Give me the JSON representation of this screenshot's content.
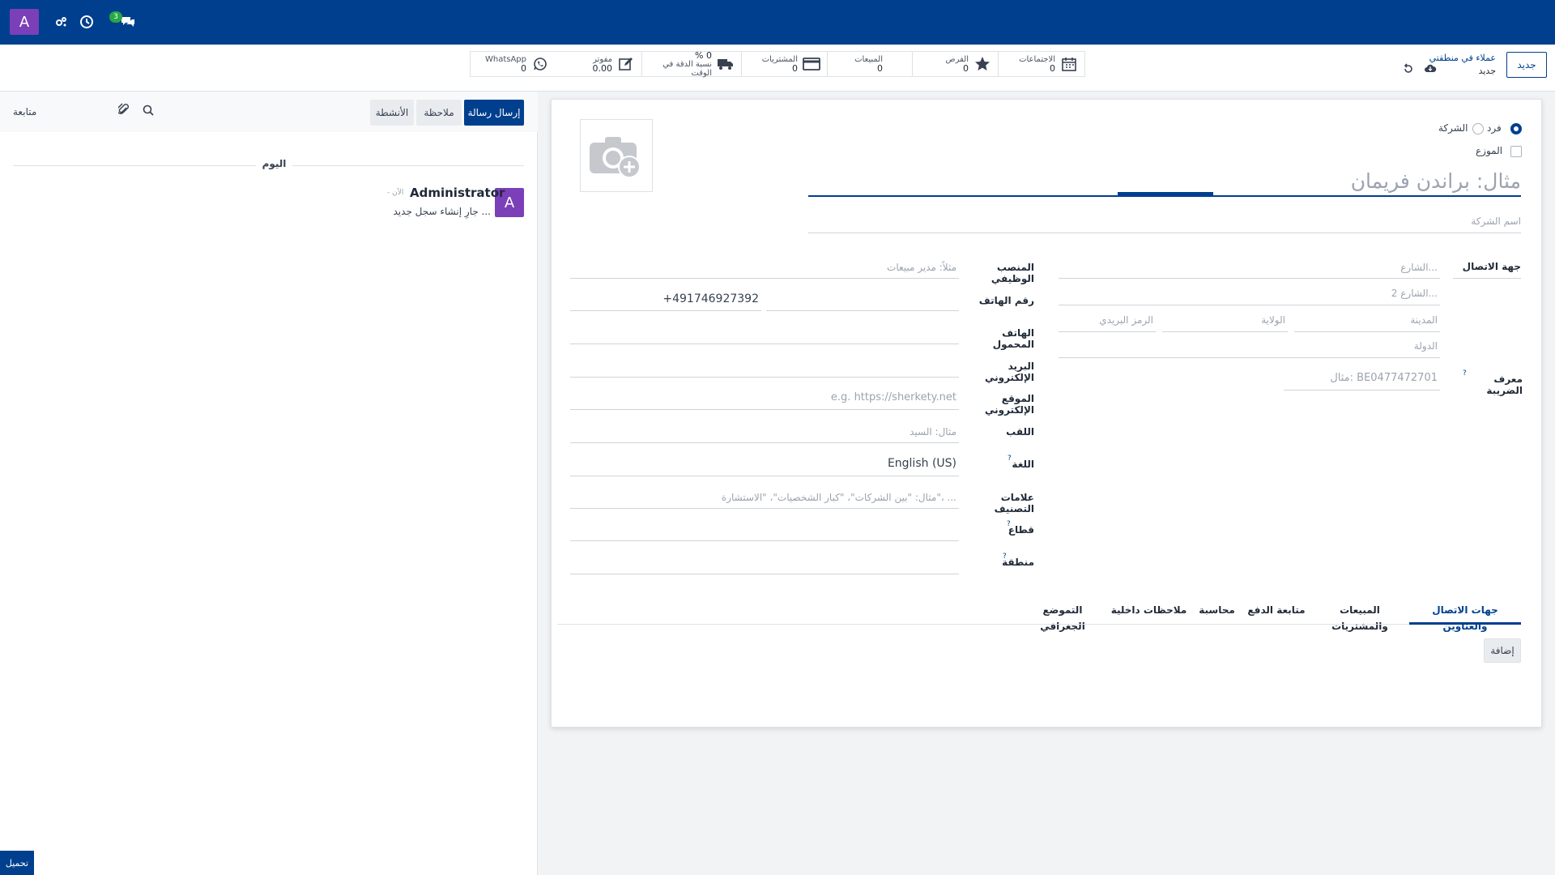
{
  "navbar": {
    "avatar_letter": "A",
    "chat_badge": "3"
  },
  "control": {
    "new_button": "جديد",
    "breadcrumb_parent": "عملاء في منطقتي",
    "breadcrumb_current": "جديد",
    "stats": [
      {
        "label": "الاجتماعات",
        "value": "0",
        "icon": "calendar-icon"
      },
      {
        "label": "الفرص",
        "value": "0",
        "icon": "star-icon"
      },
      {
        "label": "المبيعات",
        "value": "0",
        "icon": "dollar-icon"
      },
      {
        "label": "المشتريات",
        "value": "0",
        "icon": "credit-card-icon"
      },
      {
        "label": "نسبة الدقة في الوقت",
        "value": "0 %",
        "icon": "truck-icon"
      },
      {
        "label": "مفوتر",
        "value": "0.00",
        "icon": "invoice-edit-icon"
      },
      {
        "label": "WhatsApp",
        "value": "0",
        "icon": "whatsapp-icon"
      }
    ]
  },
  "chatter": {
    "send_message": "إرسال رسالة",
    "note": "ملاحظة",
    "activities": "الأنشطة",
    "follow": "متابعة",
    "date_separator": "اليوم",
    "message": {
      "author": "Administrator",
      "time": "- الآن",
      "body": "جارِ إنشاء سجل جديد ...",
      "avatar_letter": "A"
    },
    "upload_button": "تحميل"
  },
  "form": {
    "type_individual": "فرد",
    "type_company": "الشركة",
    "supplier": "الموزع",
    "name_placeholder": "مثال: براندن فريمان",
    "company_placeholder": "اسم الشركة",
    "address": {
      "label": "جهة الاتصال",
      "street": "الشارع...",
      "street2": "الشارع 2...",
      "city": "المدينة",
      "state": "الولاية",
      "zip": "الرمز البريدي",
      "country": "الدولة"
    },
    "vat": {
      "label": "معرف الضريبة",
      "placeholder": "مثال: BE0477472701"
    },
    "job": {
      "label": "المنصب الوظيفي",
      "placeholder": "مثلاً: مدير مبيعات"
    },
    "phone": {
      "label": "رقم الهاتف",
      "value": "+491746927392"
    },
    "mobile": {
      "label": "الهاتف المحمول"
    },
    "email": {
      "label": "البريد الإلكتروني"
    },
    "website": {
      "label": "الموقع الإلكتروني",
      "placeholder": "e.g. https://sherkety.net"
    },
    "title": {
      "label": "اللقب",
      "placeholder": "مثال: السيد"
    },
    "language": {
      "label": "اللغة",
      "value": "English (US)"
    },
    "tags": {
      "label": "علامات التصنيف",
      "placeholder": "مثال: \"بين الشركات\"، \"كبار الشخصيات\"، \"الاستشارة\"، ..."
    },
    "industry": {
      "label": "قطاع"
    },
    "region": {
      "label": "منطقة"
    },
    "tabs": [
      "جهات الاتصال والعناوين",
      "المبيعات والمشتريات",
      "متابعة الدفع",
      "محاسبة",
      "ملاحظات داخلية",
      "التموضع الجغرافي"
    ],
    "add_button": "إضافة"
  }
}
